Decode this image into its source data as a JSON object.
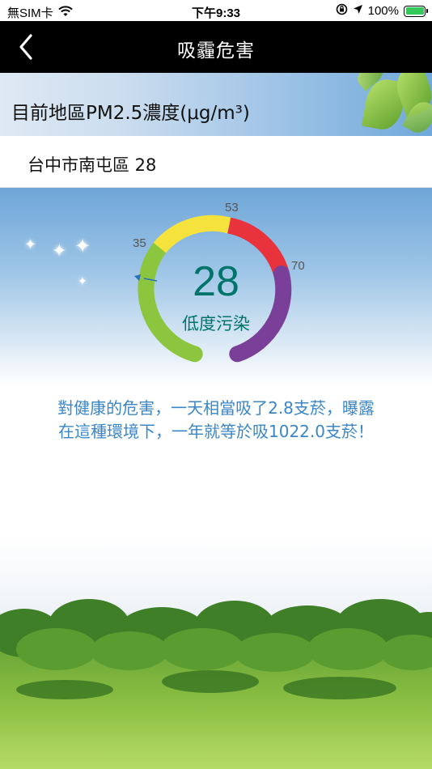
{
  "status_bar": {
    "carrier": "無SIM卡",
    "time": "下午9:33",
    "battery": "100%"
  },
  "nav": {
    "title": "吸霾危害"
  },
  "banner": {
    "title": "目前地區PM2.5濃度(μg/m³)"
  },
  "location": {
    "text": "台中市南屯區 28"
  },
  "gauge": {
    "value": "28",
    "level": "低度污染",
    "ticks": [
      "35",
      "53",
      "70"
    ],
    "colors": {
      "green": "#8cc63e",
      "yellow": "#f5e23c",
      "red": "#e8323c",
      "purple": "#7a3f98",
      "value_text": "#00746b"
    }
  },
  "health": {
    "line1": "對健康的危害，一天相當吸了2.8支菸，曝露",
    "line2": "在這種環境下，一年就等於吸1022.0支菸！"
  },
  "icons": {
    "back": "chevron-left-icon",
    "wifi": "wifi-icon",
    "lock": "orientation-lock-icon",
    "location": "location-arrow-icon",
    "battery": "battery-icon"
  }
}
